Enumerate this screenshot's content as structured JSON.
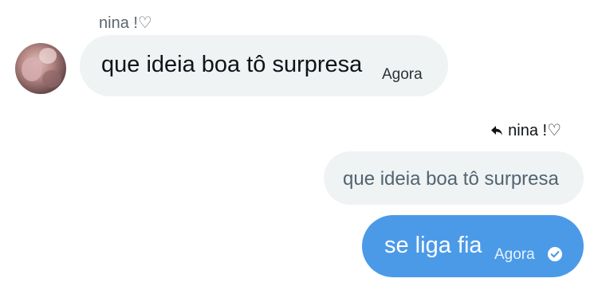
{
  "conversation": {
    "incoming": {
      "sender_name": "nina !♡",
      "avatar_icon": "avatar-photo",
      "message": "que ideia boa tô surpresa",
      "time": "Agora"
    },
    "outgoing": {
      "reply_to_name": "nina !♡",
      "reply_icon": "reply-arrow-icon",
      "quoted_message": "que ideia boa tô surpresa",
      "message": "se liga fia",
      "time": "Agora",
      "status_icon": "read-check-icon"
    }
  },
  "colors": {
    "incoming_bubble": "#eff3f4",
    "outgoing_bubble": "#4b9ae8",
    "quote_text": "#536471"
  }
}
